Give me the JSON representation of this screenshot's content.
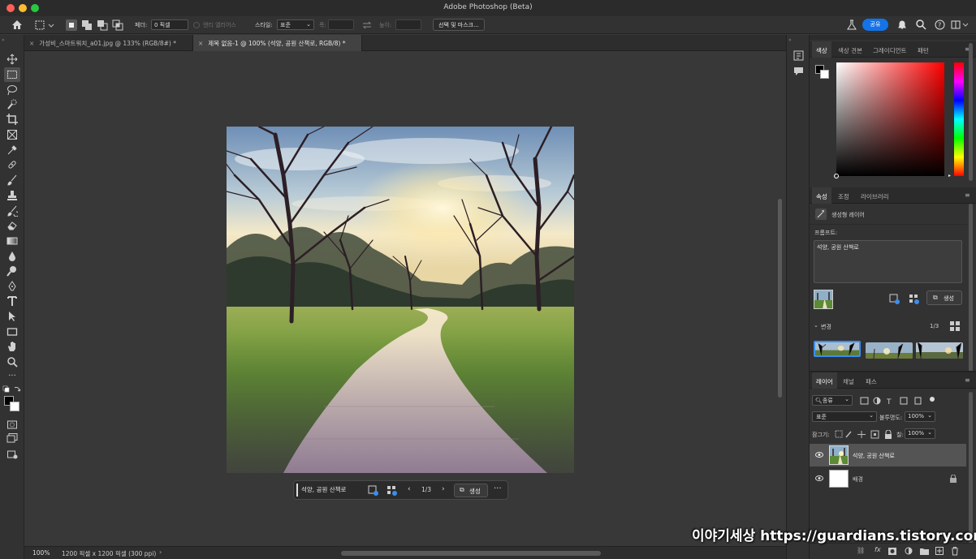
{
  "window": {
    "title": "Adobe Photoshop (Beta)"
  },
  "options_bar": {
    "feather_label": "페더:",
    "feather_value": "0 픽셀",
    "antialias_label": "앤티 앨리어스",
    "style_label": "스타일:",
    "style_value": "표준",
    "width_label": "폭:",
    "height_label": "높이:",
    "select_mask_button": "선택 및 마스크...",
    "share_button": "공유"
  },
  "document_tabs": [
    {
      "label": "가성비_스마트워치_a01.jpg @ 133% (RGB/8#) *",
      "active": false
    },
    {
      "label": "제목 없음-1 @ 100% (석양, 공원 산책로, RGB/8) *",
      "active": true
    }
  ],
  "tools": [
    "move-icon",
    "marquee-icon",
    "lasso-icon",
    "quick-select-icon",
    "crop-icon",
    "frame-icon",
    "eyedropper-icon",
    "healing-icon",
    "brush-icon",
    "stamp-icon",
    "history-brush-icon",
    "eraser-icon",
    "gradient-icon",
    "blur-icon",
    "dodge-icon",
    "pen-icon",
    "type-icon",
    "path-select-icon",
    "rectangle-icon",
    "hand-icon",
    "zoom-icon",
    "more-tools-icon"
  ],
  "context_bar": {
    "prompt": "석양, 공원 산책로",
    "counter": "1/3",
    "generate_button": "생성"
  },
  "status_bar": {
    "zoom": "100%",
    "doc_info": "1200 픽셀 x 1200 픽셀 (300 ppi)"
  },
  "color_panel": {
    "tabs": [
      "색상",
      "색상 견본",
      "그레이디언트",
      "패턴"
    ],
    "active_tab": "색상",
    "hue_base": "#ff0000"
  },
  "properties_panel": {
    "tabs": [
      "속성",
      "조정",
      "라이브러리"
    ],
    "layer_type": "생성형 레이어",
    "prompt_label": "프롬프트:",
    "prompt_value": "석양, 공원 산책로",
    "generate_button": "생성",
    "variations_label": "변경",
    "variations_count": "1/3"
  },
  "layers_panel": {
    "tabs": [
      "레이어",
      "채널",
      "패스"
    ],
    "filter_kind": "종류",
    "blend_mode": "표준",
    "opacity_label": "불투명도:",
    "opacity_value": "100%",
    "lock_label": "잠그기:",
    "fill_label": "칠:",
    "fill_value": "100%",
    "layers": [
      {
        "name": "석양, 공원 산책로",
        "selected": true
      },
      {
        "name": "배경",
        "selected": false
      }
    ]
  },
  "watermark": "이야기세상 https://guardians.tistory.com"
}
